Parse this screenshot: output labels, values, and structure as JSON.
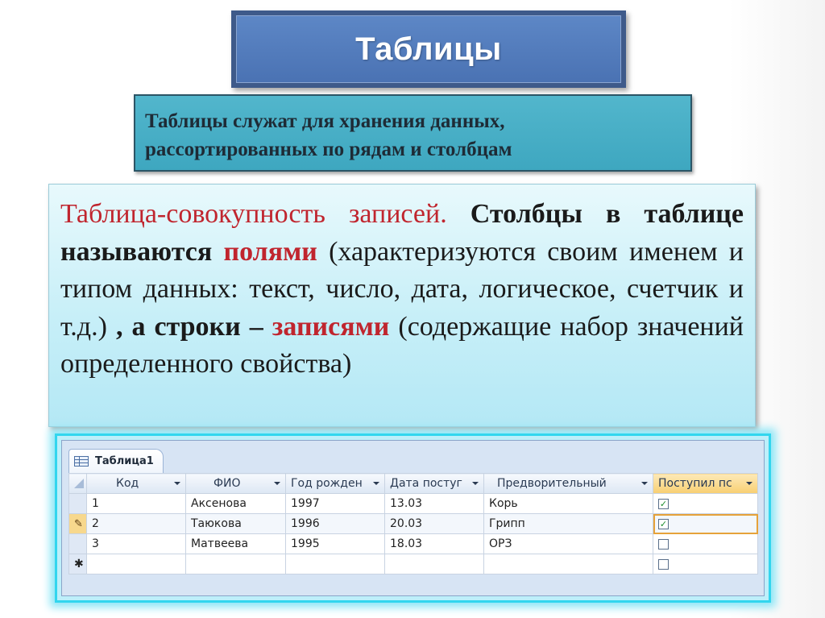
{
  "title": "Таблицы",
  "definition": {
    "line1": "Таблицы служат для хранения данных,",
    "line2": "рассортированных по рядам и столбцам"
  },
  "body": {
    "p1_plain": "Таблица-совокупность записей.",
    "p1_bold": " Столбцы в таблице называются ",
    "p1_red": "полями",
    "p1_rest": " (характеризуются своим именем и типом данных: текст, число, дата, логическое, счетчик и т.д.) ",
    "p1_bold2": ", а строки – ",
    "p1_red2": "записями",
    "p1_rest2": " (содержащие набор значений определенного свойства)"
  },
  "access_table": {
    "tab_label": "Таблица1",
    "columns": [
      "Код",
      "ФИО",
      "Год рожден",
      "Дата постуг",
      "Предворительный",
      "Поступил пс"
    ],
    "rows": [
      {
        "kod": "1",
        "fio": "Аксенова",
        "year": "1997",
        "date": "13.03",
        "pred": "Корь",
        "post": true
      },
      {
        "kod": "2",
        "fio": "Таюкова",
        "year": "1996",
        "date": "20.03",
        "pred": "Грипп",
        "post": true
      },
      {
        "kod": "3",
        "fio": "Матвеева",
        "year": "1995",
        "date": "18.03",
        "pred": "ОРЗ",
        "post": false
      }
    ],
    "new_row_marker": "✱",
    "current_row_marker": "✎"
  },
  "colors": {
    "title_bg": "#4a72b3",
    "definition_bg": "#3ea7c0",
    "text_box_bg": "#c7eff8",
    "accent_red": "#c0252e"
  }
}
